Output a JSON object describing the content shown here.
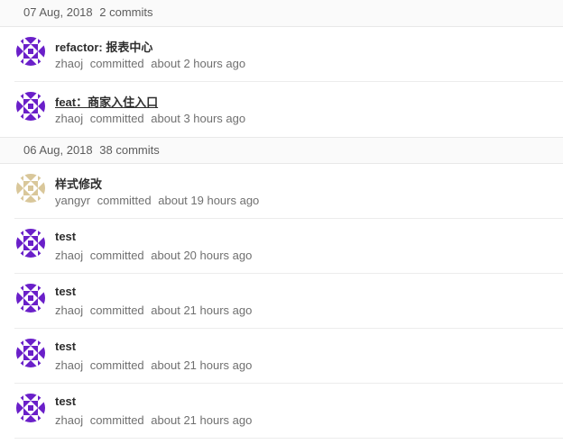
{
  "groups": [
    {
      "date": "07 Aug, 2018",
      "count": "2 commits",
      "commits": [
        {
          "title": "refactor: 报表中心",
          "author": "zhaoj",
          "verb": "committed",
          "time": "about 2 hours ago",
          "avatar_color": "#6a1fc9"
        },
        {
          "title": "feat：商家入住入口",
          "author": "zhaoj",
          "verb": "committed",
          "time": "about 3 hours ago",
          "avatar_color": "#6a1fc9"
        }
      ]
    },
    {
      "date": "06 Aug, 2018",
      "count": "38 commits",
      "commits": [
        {
          "title": "样式修改",
          "author": "yangyr",
          "verb": "committed",
          "time": "about 19 hours ago",
          "avatar_color": "#d9c79a"
        },
        {
          "title": "test",
          "author": "zhaoj",
          "verb": "committed",
          "time": "about 20 hours ago",
          "avatar_color": "#6a1fc9"
        },
        {
          "title": "test",
          "author": "zhaoj",
          "verb": "committed",
          "time": "about 21 hours ago",
          "avatar_color": "#6a1fc9"
        },
        {
          "title": "test",
          "author": "zhaoj",
          "verb": "committed",
          "time": "about 21 hours ago",
          "avatar_color": "#6a1fc9"
        },
        {
          "title": "test",
          "author": "zhaoj",
          "verb": "committed",
          "time": "about 21 hours ago",
          "avatar_color": "#6a1fc9"
        }
      ]
    }
  ]
}
